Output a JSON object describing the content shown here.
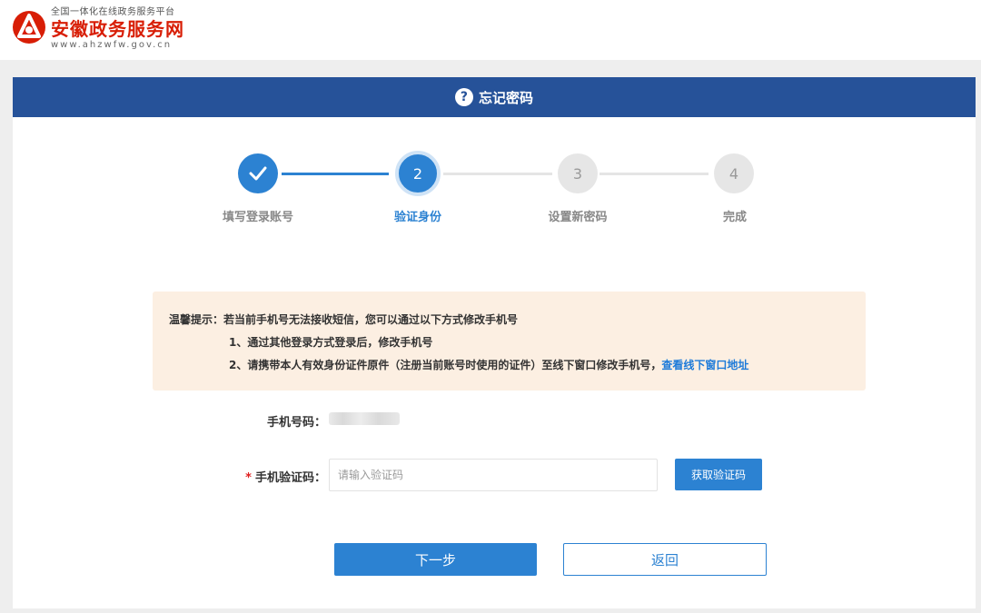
{
  "brand": {
    "tagline": "全国一体化在线政务服务平台",
    "name": "安徽政务服务网",
    "url": "www.ahzwfw.gov.cn",
    "color": "#d81e06"
  },
  "card": {
    "title": "忘记密码",
    "header_color": "#265299"
  },
  "steps": [
    {
      "number": "",
      "label": "填写登录账号",
      "state": "done"
    },
    {
      "number": "2",
      "label": "验证身份",
      "state": "current"
    },
    {
      "number": "3",
      "label": "设置新密码",
      "state": "todo"
    },
    {
      "number": "4",
      "label": "完成",
      "state": "todo"
    }
  ],
  "notice": {
    "line1": "温馨提示：若当前手机号无法接收短信，您可以通过以下方式修改手机号",
    "line2": "1、通过其他登录方式登录后，修改手机号",
    "line3": "2、请携带本人有效身份证件原件（注册当前账号时使用的证件）至线下窗口修改手机号，",
    "link": "查看线下窗口地址"
  },
  "form": {
    "phone_label": "手机号码：",
    "code_required_mark": "*",
    "code_label": "手机验证码：",
    "code_placeholder": "请输入验证码",
    "get_code_button": "获取验证码"
  },
  "actions": {
    "next": "下一步",
    "back": "返回"
  },
  "accent_color": "#2c82d2"
}
